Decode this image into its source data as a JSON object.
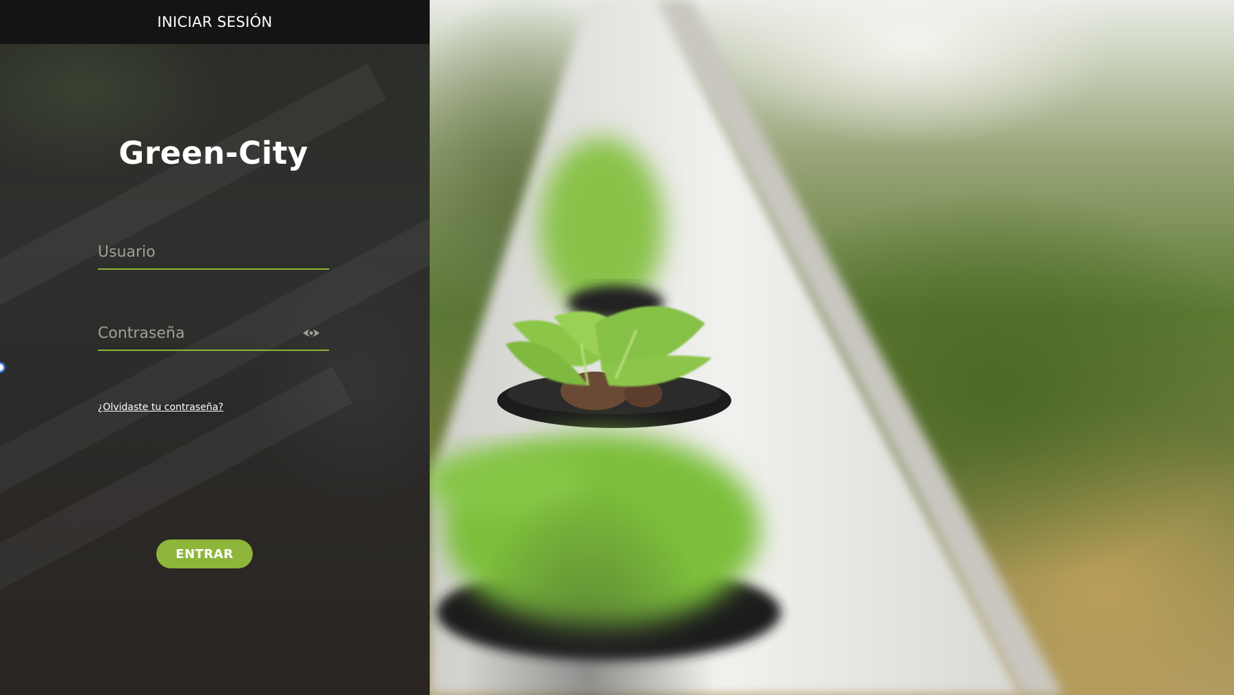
{
  "header": {
    "title": "INICIAR SESIÓN"
  },
  "brand": {
    "name": "Green-City"
  },
  "form": {
    "username": {
      "placeholder": "Usuario",
      "value": ""
    },
    "password": {
      "placeholder": "Contraseña",
      "value": "",
      "toggle_icon": "eye-icon"
    },
    "forgot_link": "¿Olvidaste tu contraseña?",
    "submit_label": "ENTRAR"
  },
  "colors": {
    "accent": "#8db63a",
    "header_bg": "#141414",
    "panel_bg": "#2b2c29",
    "text": "#ffffff",
    "placeholder": "#a0a09a"
  },
  "background": {
    "image": "hydroponic-lettuce-photo"
  }
}
